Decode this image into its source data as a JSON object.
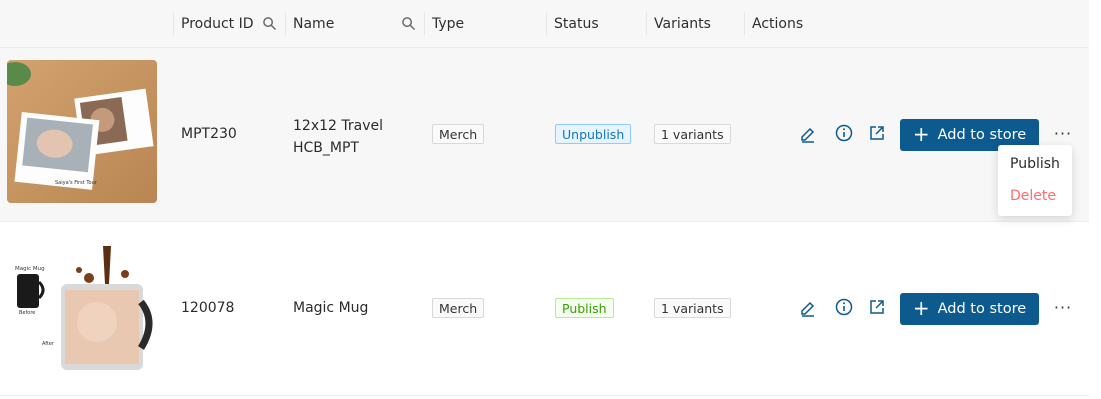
{
  "header": {
    "product_id": "Product ID",
    "name": "Name",
    "type": "Type",
    "status": "Status",
    "variants": "Variants",
    "actions": "Actions",
    "search_icons": [
      "search-icon",
      "search-icon"
    ]
  },
  "rows": [
    {
      "id": "MPT230",
      "name_line1": "12x12 Travel",
      "name_line2": "HCB_MPT",
      "type": "Merch",
      "status": "Unpublish",
      "variants": "1 variants",
      "add_label": "Add to store",
      "thumb_text": "Saiya's First Tour"
    },
    {
      "id": "120078",
      "name": "Magic Mug",
      "type": "Merch",
      "status": "Publish",
      "variants": "1 variants",
      "add_label": "Add to store",
      "thumb_labels": [
        "Magic Mug",
        "Before",
        "After"
      ]
    }
  ],
  "dropdown": {
    "publish": "Publish",
    "delete": "Delete"
  },
  "colors": {
    "primary": "#0d5a8f",
    "danger": "#ff6b6b",
    "unpublish_text": "#1677b8",
    "publish_text": "#389e0d"
  },
  "icons": {
    "actions": [
      "edit-icon",
      "info-icon",
      "external-link-icon",
      "plus-icon",
      "more-icon"
    ]
  }
}
